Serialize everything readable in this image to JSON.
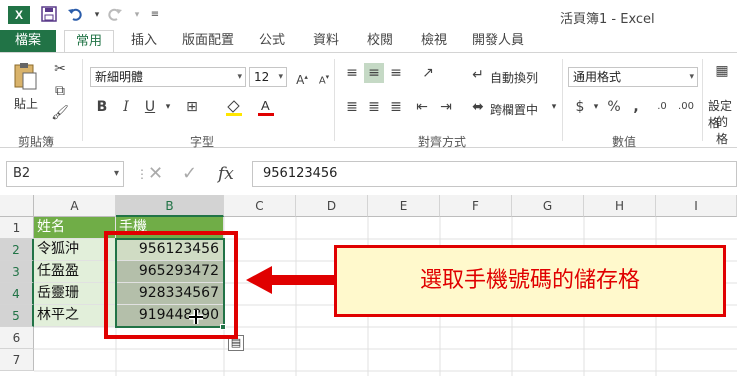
{
  "window": {
    "title": "活頁簿1 - Excel",
    "app_logo": "X"
  },
  "quick_access": [
    "save-icon",
    "undo-icon",
    "redo-icon",
    "customize-icon"
  ],
  "tabs": [
    "檔案",
    "常用",
    "插入",
    "版面配置",
    "公式",
    "資料",
    "校閱",
    "檢視",
    "開發人員"
  ],
  "ribbon": {
    "clipboard": {
      "paste_label": "貼上",
      "group_label": "剪貼簿"
    },
    "font": {
      "font_name": "新細明體",
      "font_size": "12",
      "group_label": "字型"
    },
    "alignment": {
      "wrap_text": "自動換列",
      "merge_center": "跨欄置中",
      "group_label": "對齊方式"
    },
    "number": {
      "format": "通用格式",
      "currency": "$",
      "percent": "%",
      "comma": ",",
      "group_label": "數值"
    },
    "styles": {
      "conditional_format": "設定格",
      "conditional_format_2": "的格"
    }
  },
  "formula_bar": {
    "name_box": "B2",
    "fx": "fx",
    "value": "956123456"
  },
  "columns": [
    "A",
    "B",
    "C",
    "D",
    "E",
    "F",
    "G",
    "H",
    "I"
  ],
  "rows": [
    "1",
    "2",
    "3",
    "4",
    "5",
    "6",
    "7"
  ],
  "sheet": {
    "header": [
      "姓名",
      "手機"
    ],
    "data": [
      [
        "令狐沖",
        "956123456"
      ],
      [
        "任盈盈",
        "965293472"
      ],
      [
        "岳靈珊",
        "928334567"
      ],
      [
        "林平之",
        "919448890"
      ]
    ]
  },
  "annotation": "選取手機號碼的儲存格",
  "colors": {
    "excel_green": "#217346",
    "header_fill": "#70ad47",
    "data_fill": "#e2efda",
    "selection_fill": "#b4bfaa",
    "annotation_red": "#e00000",
    "callout_fill": "#fff9cc"
  }
}
